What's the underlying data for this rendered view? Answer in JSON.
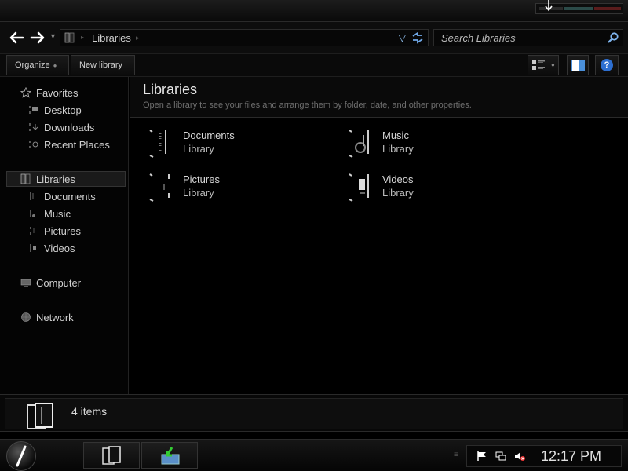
{
  "window": {
    "buttons": [
      "minimize",
      "maximize",
      "close"
    ]
  },
  "navigation": {
    "back_icon": "arrow-left-icon",
    "forward_icon": "arrow-right-icon",
    "address_crumb": "Libraries",
    "search_placeholder": "Search Libraries"
  },
  "toolbar": {
    "organize_label": "Organize",
    "new_library_label": "New library",
    "help_label": "?"
  },
  "sidebar": {
    "favorites": "Favorites",
    "desktop": "Desktop",
    "downloads": "Downloads",
    "recent_places": "Recent Places",
    "libraries": "Libraries",
    "documents": "Documents",
    "music": "Music",
    "pictures": "Pictures",
    "videos": "Videos",
    "computer": "Computer",
    "network": "Network"
  },
  "content": {
    "title": "Libraries",
    "subtitle": "Open a library to see your files and arrange them by folder, date, and other properties.",
    "libraries": [
      {
        "name": "Documents",
        "type": "Library"
      },
      {
        "name": "Music",
        "type": "Library"
      },
      {
        "name": "Pictures",
        "type": "Library"
      },
      {
        "name": "Videos",
        "type": "Library"
      }
    ]
  },
  "details": {
    "count_text": "4 items"
  },
  "taskbar": {
    "clock": "12:17 PM"
  },
  "colors": {
    "background": "#000000",
    "help_blue": "#2d6fd1",
    "accent_teal": "#2b4a48",
    "close_red": "#5a1c1c"
  }
}
